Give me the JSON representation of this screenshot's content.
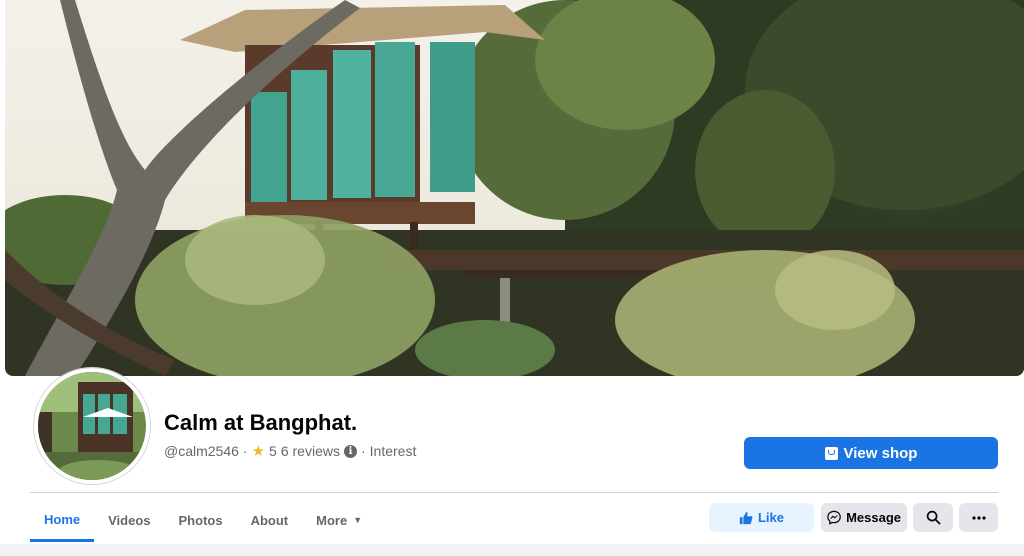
{
  "page": {
    "name": "Calm at Bangphat.",
    "handle": "@calm2546",
    "separator": "·",
    "rating": "5",
    "reviews": "6 reviews",
    "category": "Interest"
  },
  "buttons": {
    "view_shop": "View shop",
    "like": "Like",
    "message": "Message"
  },
  "tabs": [
    {
      "label": "Home",
      "active": true
    },
    {
      "label": "Videos"
    },
    {
      "label": "Photos"
    },
    {
      "label": "About"
    },
    {
      "label": "More"
    }
  ],
  "icons": {
    "rating": "star-icon",
    "info": "info-icon",
    "shop": "shop-icon",
    "like": "thumbs-up-icon",
    "message": "messenger-icon",
    "search": "search-icon",
    "more": "ellipsis-icon",
    "more_tab": "caret-down-icon"
  },
  "colors": {
    "accent": "#1b74e4",
    "accent_light": "#e7f3ff",
    "secondary_button": "#e4e6eb",
    "text_primary": "#050505",
    "text_secondary": "#65676b",
    "star": "#f7b928"
  }
}
